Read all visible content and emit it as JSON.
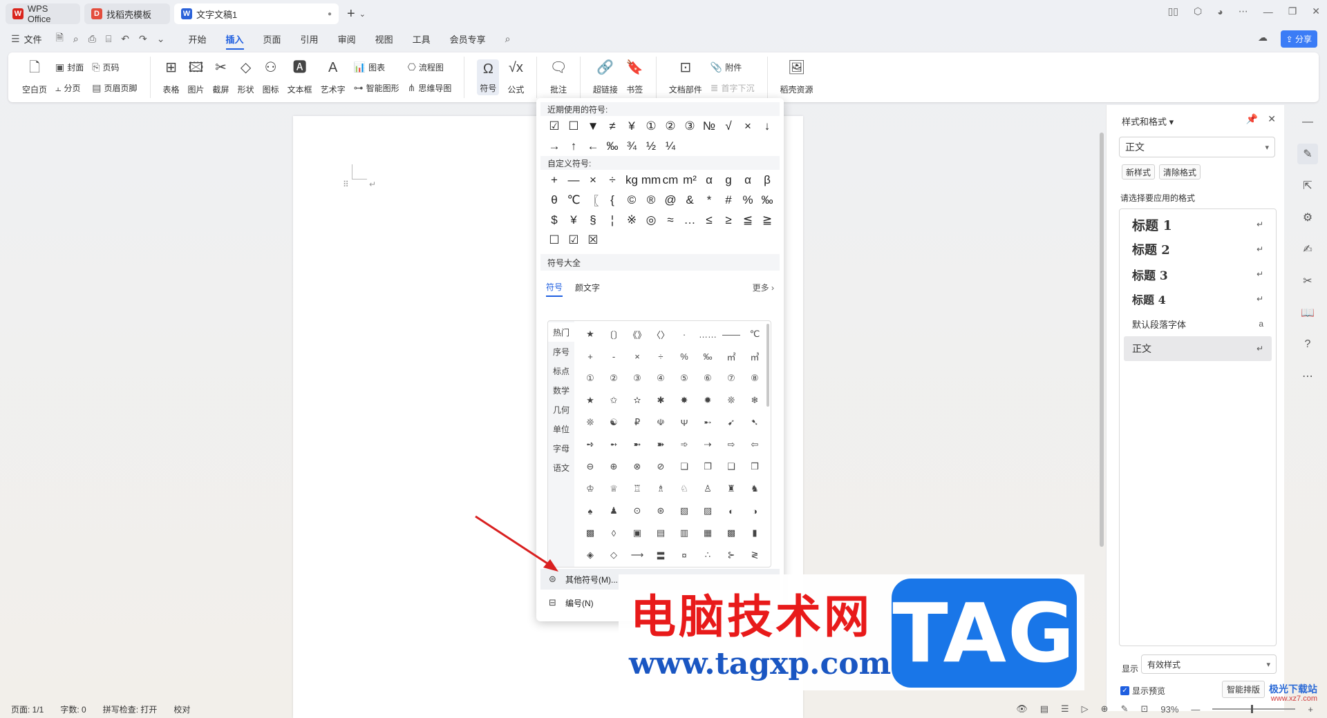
{
  "tabs": [
    {
      "label": "WPS Office",
      "color": "#d9251d"
    },
    {
      "label": "找稻壳模板",
      "color": "#e34d3d"
    },
    {
      "label": "文字文稿1",
      "color": "#2b62d9"
    }
  ],
  "menubar": {
    "file": "文件",
    "items": [
      "开始",
      "插入",
      "页面",
      "引用",
      "审阅",
      "视图",
      "工具",
      "会员专享"
    ],
    "active": "插入",
    "share": "分享"
  },
  "ribbon": {
    "blank_page": "空白页",
    "cover": "封面",
    "page_break": "分页",
    "page_num": "页码",
    "header_footer": "页眉页脚",
    "table": "表格",
    "picture": "图片",
    "screenshot": "截屏",
    "shape": "形状",
    "icon": "图标",
    "textbox": "文本框",
    "wordart": "艺术字",
    "chart": "图表",
    "smartart": "智能图形",
    "flowchart": "流程图",
    "mindmap": "思维导图",
    "symbol": "符号",
    "formula": "公式",
    "comment": "批注",
    "hyperlink": "超链接",
    "bookmark": "书签",
    "doc_parts": "文档部件",
    "attachment": "附件",
    "dropcap": "首字下沉",
    "resources": "稻壳资源"
  },
  "symbol_dropdown": {
    "recent_title": "近期使用的符号:",
    "recent": [
      "☑",
      "☐",
      "▼",
      "≠",
      "¥",
      "①",
      "②",
      "③",
      "№",
      "√",
      "×",
      "↓",
      "→",
      "↑",
      "←",
      "‰",
      "¾",
      "½",
      "¼"
    ],
    "custom_title": "自定义符号:",
    "custom": [
      "+",
      "—",
      "×",
      "÷",
      "kg",
      "mm",
      "cm",
      "m²",
      "α",
      "g",
      "α",
      "β",
      "θ",
      "℃",
      "〖",
      "{",
      "©",
      "®",
      "@",
      "&",
      "*",
      "#",
      "%",
      "‰",
      "$",
      "¥",
      "§",
      "¦",
      "※",
      "◎",
      "≈",
      "…",
      "≤",
      "≥",
      "≦",
      "≧",
      "☐",
      "☑",
      "☒"
    ],
    "all_title": "符号大全",
    "tabs": [
      "符号",
      "颜文字"
    ],
    "more": "更多",
    "categories": [
      "热门",
      "序号",
      "标点",
      "数学",
      "几何",
      "单位",
      "字母",
      "语文"
    ],
    "grid": [
      "★",
      "〔〕",
      "《》",
      "〈〉",
      "·",
      "……",
      "——",
      "℃",
      "+",
      "-",
      "×",
      "÷",
      "%",
      "‰",
      "㎡",
      "㎥",
      "①",
      "②",
      "③",
      "④",
      "⑤",
      "⑥",
      "⑦",
      "⑧",
      "★",
      "✩",
      "✫",
      "✱",
      "✸",
      "✹",
      "❊",
      "❄",
      "❊",
      "☯",
      "₽",
      "☫",
      "Ψ",
      "➸",
      "➹",
      "➷",
      "➺",
      "➻",
      "➼",
      "➽",
      "➾",
      "⇢",
      "⇨",
      "⇦",
      "⊖",
      "⊕",
      "⊗",
      "⊘",
      "❏",
      "❐",
      "❑",
      "❒",
      "♔",
      "♕",
      "♖",
      "♗",
      "♘",
      "♙",
      "♜",
      "♞",
      "♠",
      "♟",
      "⊙",
      "⊛",
      "▧",
      "▨",
      "◐",
      "◑",
      "▩",
      "◊",
      "▣",
      "▤",
      "▥",
      "▦",
      "▩",
      "▮",
      "◈",
      "◇",
      "⟶",
      "〓",
      "¤",
      "∴",
      "⊱",
      "≷"
    ],
    "other": "其他符号(M)...",
    "numbering": "编号(N)"
  },
  "right_panel": {
    "title": "样式和格式",
    "current": "正文",
    "new_style": "新样式",
    "clear_format": "清除格式",
    "choose_label": "请选择要应用的格式",
    "styles": [
      {
        "name": "标题  1",
        "size": 19,
        "bold": true,
        "mark": "↵"
      },
      {
        "name": "标题  2",
        "size": 18,
        "bold": true,
        "mark": "↵"
      },
      {
        "name": "标题  3",
        "size": 17,
        "bold": true,
        "mark": "↵"
      },
      {
        "name": "标题  4",
        "size": 16,
        "bold": true,
        "mark": "↵"
      },
      {
        "name": "默认段落字体",
        "size": 13,
        "bold": false,
        "mark": "a"
      },
      {
        "name": "正文",
        "size": 14,
        "bold": false,
        "mark": "↵"
      }
    ],
    "show_label": "显示",
    "show_value": "有效样式",
    "preview_label": "显示预览",
    "smart_label": "智能排版"
  },
  "status": {
    "page": "页面: 1/1",
    "words": "字数: 0",
    "spell": "拼写检查: 打开",
    "proof": "校对",
    "zoom": "93%"
  },
  "watermark": {
    "cn": "电脑技术网",
    "url": "www.tagxp.com",
    "tag": "TAG",
    "brand2": "极光下载站",
    "brand2_url": "www.xz7.com"
  }
}
